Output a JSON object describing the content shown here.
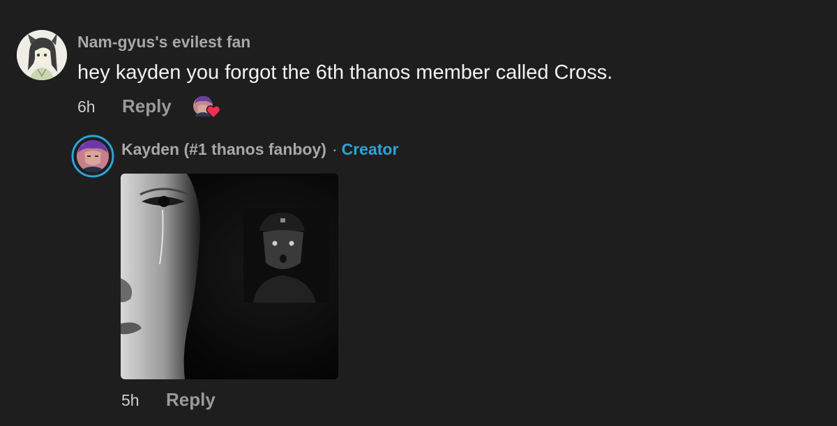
{
  "comment": {
    "username": "Nam-gyus's evilest fan",
    "text": "hey kayden you forgot the 6th thanos member called Cross.",
    "time": "6h",
    "reply_label": "Reply",
    "creator_liked": true,
    "avatar_icon": "anime-character-avatar"
  },
  "reply": {
    "username": "Kayden (#1 thanos fanboy)",
    "separator": "·",
    "badge": "Creator",
    "badge_color": "#2aa4d9",
    "time": "5h",
    "reply_label": "Reply",
    "avatar_icon": "purple-hair-avatar",
    "attachment": "meme-image"
  },
  "colors": {
    "background": "#1e1e1e",
    "like_heart": "#fe2c55",
    "avatar_ring": "#2aa4d9"
  }
}
